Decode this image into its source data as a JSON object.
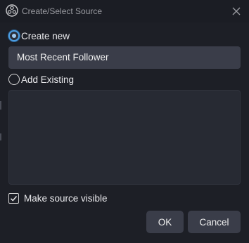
{
  "window": {
    "title": "Create/Select Source"
  },
  "icons": {
    "app": "obs-logo-icon",
    "close": "close-icon",
    "checkmark": "checkmark-icon"
  },
  "options": {
    "create_new_label": "Create new",
    "create_new_selected": true,
    "source_name_value": "Most Recent Follower",
    "add_existing_label": "Add Existing",
    "add_existing_selected": false,
    "existing_sources": []
  },
  "visibility": {
    "make_visible_label": "Make source visible",
    "make_visible_checked": true
  },
  "buttons": {
    "ok_label": "OK",
    "cancel_label": "Cancel"
  },
  "colors": {
    "background": "#1d1f26",
    "accent": "#4d9de0",
    "field": "#3a3d49",
    "list": "#272a33"
  }
}
